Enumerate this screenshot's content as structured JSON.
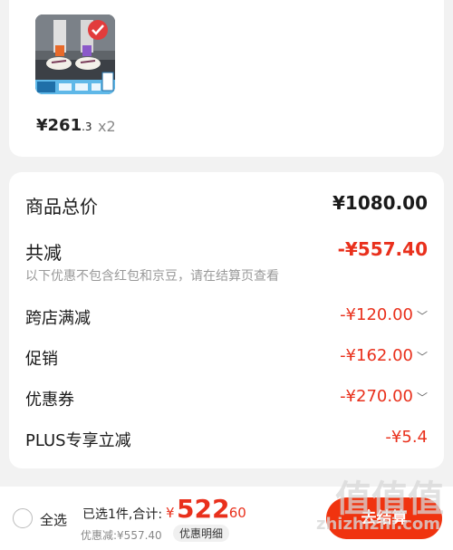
{
  "product": {
    "price_int": "¥261",
    "price_dec": ".3",
    "quantity": "x2",
    "thumb_icons": [
      "check-badge-icon"
    ]
  },
  "summary": {
    "total_label": "商品总价",
    "total_value": "¥1080.00",
    "reduce_label": "共减",
    "reduce_value": "-¥557.40",
    "note": "以下优惠不包含红包和京豆，请在结算页查看",
    "items": [
      {
        "label": "跨店满减",
        "value": "-¥120.00"
      },
      {
        "label": "促销",
        "value": "-¥162.00"
      },
      {
        "label": "优惠券",
        "value": "-¥270.00"
      },
      {
        "label": "PLUS专享立减",
        "value": "-¥5.4"
      }
    ]
  },
  "bottom": {
    "select_all": "全选",
    "selected_info": "已选1件,合计:",
    "total_currency": "¥",
    "total_int": "522",
    "total_dec": ".60",
    "saving": "优惠减:¥557.40",
    "detail": "优惠明细",
    "checkout": "去结算"
  },
  "watermark": {
    "chars": "值值值",
    "url": "zhizhizhi.com"
  },
  "colors": {
    "accent_red": "#e9301c",
    "checkout_bg": "#f0330f",
    "page_bg": "#f2f2f2"
  }
}
